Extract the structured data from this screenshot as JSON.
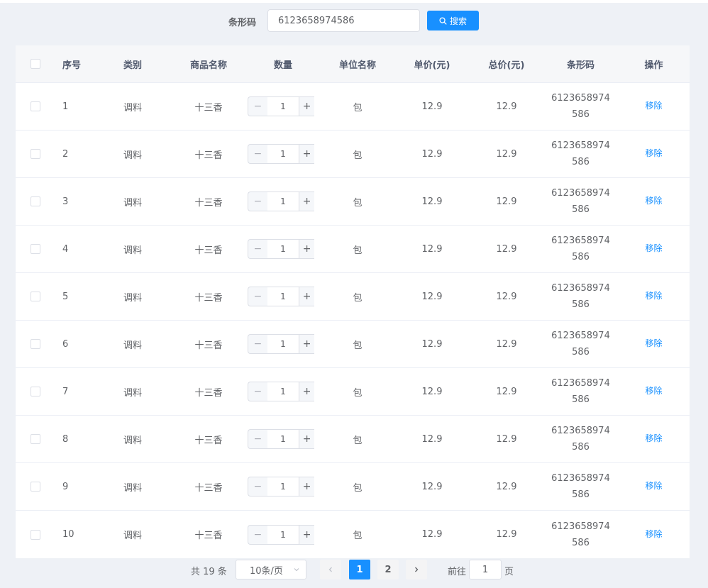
{
  "search": {
    "label": "条形码",
    "value": "6123658974586",
    "button_label": "搜索"
  },
  "table": {
    "headers": {
      "index": "序号",
      "category": "类别",
      "name": "商品名称",
      "quantity": "数量",
      "unit": "单位名称",
      "unit_price": "单价(元)",
      "total_price": "总价(元)",
      "barcode": "条形码",
      "action": "操作"
    },
    "rows": [
      {
        "index": "1",
        "category": "调料",
        "name": "十三香",
        "quantity": "1",
        "unit": "包",
        "unit_price": "12.9",
        "total_price": "12.9",
        "barcode": "6123658974586",
        "action": "移除"
      },
      {
        "index": "2",
        "category": "调料",
        "name": "十三香",
        "quantity": "1",
        "unit": "包",
        "unit_price": "12.9",
        "total_price": "12.9",
        "barcode": "6123658974586",
        "action": "移除"
      },
      {
        "index": "3",
        "category": "调料",
        "name": "十三香",
        "quantity": "1",
        "unit": "包",
        "unit_price": "12.9",
        "total_price": "12.9",
        "barcode": "6123658974586",
        "action": "移除"
      },
      {
        "index": "4",
        "category": "调料",
        "name": "十三香",
        "quantity": "1",
        "unit": "包",
        "unit_price": "12.9",
        "total_price": "12.9",
        "barcode": "6123658974586",
        "action": "移除"
      },
      {
        "index": "5",
        "category": "调料",
        "name": "十三香",
        "quantity": "1",
        "unit": "包",
        "unit_price": "12.9",
        "total_price": "12.9",
        "barcode": "6123658974586",
        "action": "移除"
      },
      {
        "index": "6",
        "category": "调料",
        "name": "十三香",
        "quantity": "1",
        "unit": "包",
        "unit_price": "12.9",
        "total_price": "12.9",
        "barcode": "6123658974586",
        "action": "移除"
      },
      {
        "index": "7",
        "category": "调料",
        "name": "十三香",
        "quantity": "1",
        "unit": "包",
        "unit_price": "12.9",
        "total_price": "12.9",
        "barcode": "6123658974586",
        "action": "移除"
      },
      {
        "index": "8",
        "category": "调料",
        "name": "十三香",
        "quantity": "1",
        "unit": "包",
        "unit_price": "12.9",
        "total_price": "12.9",
        "barcode": "6123658974586",
        "action": "移除"
      },
      {
        "index": "9",
        "category": "调料",
        "name": "十三香",
        "quantity": "1",
        "unit": "包",
        "unit_price": "12.9",
        "total_price": "12.9",
        "barcode": "6123658974586",
        "action": "移除"
      },
      {
        "index": "10",
        "category": "调料",
        "name": "十三香",
        "quantity": "1",
        "unit": "包",
        "unit_price": "12.9",
        "total_price": "12.9",
        "barcode": "6123658974586",
        "action": "移除"
      }
    ],
    "stepper": {
      "minus": "−",
      "plus": "+"
    }
  },
  "pagination": {
    "total_label": "共 19 条",
    "page_size": "10条/页",
    "pages": [
      "1",
      "2"
    ],
    "current_page": "1",
    "goto_label": "前往",
    "goto_value": "1",
    "page_suffix": "页"
  },
  "colors": {
    "accent": "#1890ff",
    "background": "#eef1f6",
    "header_bg": "#f6f7f9"
  },
  "icons": {
    "search": "search-icon",
    "page_size_dropdown": "chevron-down-icon",
    "prev": "chevron-left-icon",
    "next": "chevron-right-icon"
  }
}
